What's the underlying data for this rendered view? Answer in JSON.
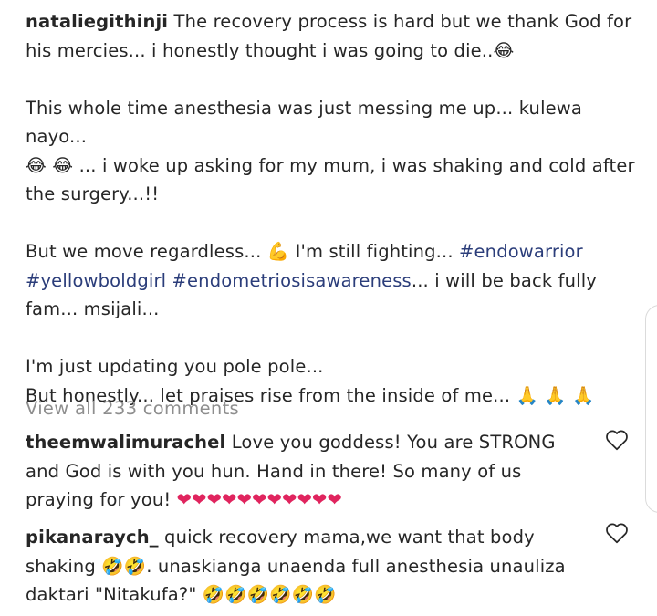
{
  "post": {
    "username": "nataliegithinji",
    "line1": " The recovery process is hard but we thank God for his mercies... i honestly thought i was going to die..",
    "line1_emoji": "😂",
    "para2_a": "This whole time anesthesia was just messing me up... kulewa nayo...",
    "para2_emojis": "😂 😂",
    "para2_b": " ... i woke up asking for my mum, i was shaking and cold after the surgery...!!",
    "para3_a": "But we move regardless... ",
    "para3_emoji": "💪",
    "para3_b": " I'm still fighting... ",
    "hashtag_1": "#endowarrior",
    "hashtag_2": "#yellowboldgirl",
    "hashtag_3": "#endometriosisawareness",
    "para3_c": "... i will be back fully fam... msijali...",
    "para4_a": "I'm just updating you pole pole...",
    "para4_b": "But honestly... let praises rise from the inside of me... ",
    "para4_emojis": "🙏 🙏 🙏"
  },
  "comments_link": "View all 233 comments",
  "comments": [
    {
      "username": "theemwalimurachel",
      "text": " Love you goddess! You are STRONG and God is with you hun. Hand in there! So many of us praying for you! ",
      "emojis": "❤❤❤❤❤❤❤❤❤❤❤",
      "like_icon": "heart-outline-icon"
    },
    {
      "username": "pikanaraych_",
      "text_a": " quick recovery mama,we want that body shaking ",
      "emojis_a": "🤣🤣",
      "text_b": ". unaskianga unaenda full anesthesia unauliza daktari \"Nitakufa?\" ",
      "emojis_b": "🤣🤣🤣🤣🤣🤣",
      "like_icon": "heart-outline-icon"
    }
  ],
  "colors": {
    "text": "#262626",
    "hashtag": "#2b3d7a",
    "muted": "#8e8e8e",
    "heart_red": "#e0245e"
  }
}
